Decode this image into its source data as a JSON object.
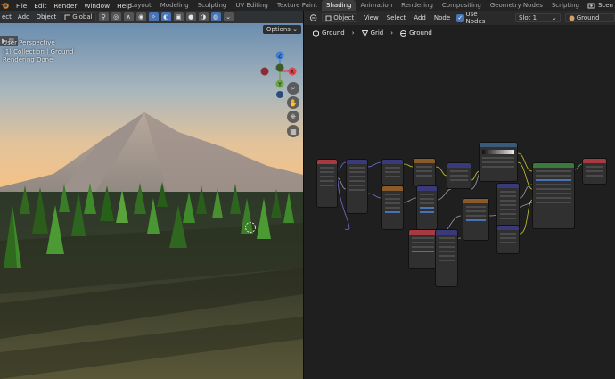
{
  "topbar": {
    "menu": [
      "File",
      "Edit",
      "Render",
      "Window",
      "Help"
    ],
    "tabs": [
      "Layout",
      "Modeling",
      "Sculpting",
      "UV Editing",
      "Texture Paint",
      "Shading",
      "Animation",
      "Rendering",
      "Compositing",
      "Geometry Nodes",
      "Scripting"
    ],
    "active_tab": "Shading",
    "add_tab": "+",
    "scene": "Scen"
  },
  "viewport": {
    "select_menu": "ect",
    "add_menu": "Add",
    "object_menu": "Object",
    "orientation": "Global",
    "overlay_lines": [
      "User Perspective",
      "(1) Collection | Ground",
      "Rendering Done"
    ],
    "options": "Options",
    "gizmo_axes": {
      "x": "X",
      "y": "Y",
      "z": "Z"
    },
    "colors": {
      "x": "#e0434e",
      "y": "#6fa241",
      "z": "#3f7fd8",
      "sky_top": "#6b8fb4",
      "sky_horizon": "#f3c48c"
    }
  },
  "node_editor": {
    "mode": "Object",
    "menus": [
      "View",
      "Select",
      "Add",
      "Node"
    ],
    "use_nodes": "Use Nodes",
    "slot": "Slot 1",
    "material": "Ground",
    "breadcrumbs": [
      "Ground",
      "Grid",
      "Ground"
    ]
  }
}
